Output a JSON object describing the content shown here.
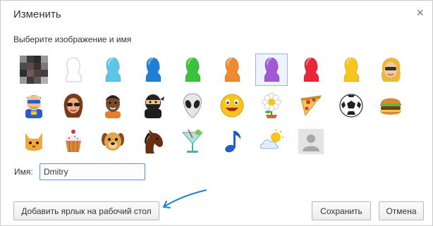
{
  "dialog": {
    "title": "Изменить",
    "close_glyph": "×",
    "subtitle": "Выберите изображение и имя",
    "selected_avatar": "avatar-purple",
    "avatars": [
      {
        "name": "avatar-pixelated-photo",
        "row": 0,
        "col": 0
      },
      {
        "name": "avatar-white",
        "row": 0,
        "col": 1,
        "color": "#ffffff"
      },
      {
        "name": "avatar-cyan",
        "row": 0,
        "col": 2,
        "color": "#5bc6e8"
      },
      {
        "name": "avatar-blue",
        "row": 0,
        "col": 3,
        "color": "#1f7fd6"
      },
      {
        "name": "avatar-green",
        "row": 0,
        "col": 4,
        "color": "#39c23a"
      },
      {
        "name": "avatar-orange",
        "row": 0,
        "col": 5,
        "color": "#f08a2c"
      },
      {
        "name": "avatar-purple",
        "row": 0,
        "col": 6,
        "color": "#a159d6"
      },
      {
        "name": "avatar-red",
        "row": 0,
        "col": 7,
        "color": "#e8283a"
      },
      {
        "name": "avatar-yellow",
        "row": 0,
        "col": 8,
        "color": "#f7c51b"
      },
      {
        "name": "avatar-blonde-woman",
        "row": 0,
        "col": 9
      },
      {
        "name": "avatar-superhero",
        "row": 1,
        "col": 0
      },
      {
        "name": "avatar-woman-sunglasses",
        "row": 1,
        "col": 1
      },
      {
        "name": "avatar-man",
        "row": 1,
        "col": 2
      },
      {
        "name": "avatar-ninja",
        "row": 1,
        "col": 3
      },
      {
        "name": "avatar-alien",
        "row": 1,
        "col": 4
      },
      {
        "name": "avatar-smiley",
        "row": 1,
        "col": 5
      },
      {
        "name": "avatar-flower",
        "row": 1,
        "col": 6
      },
      {
        "name": "avatar-pizza",
        "row": 1,
        "col": 7
      },
      {
        "name": "avatar-soccer-ball",
        "row": 1,
        "col": 8
      },
      {
        "name": "avatar-burger",
        "row": 1,
        "col": 9
      },
      {
        "name": "avatar-cat",
        "row": 2,
        "col": 0
      },
      {
        "name": "avatar-cupcake",
        "row": 2,
        "col": 1
      },
      {
        "name": "avatar-dog",
        "row": 2,
        "col": 2
      },
      {
        "name": "avatar-horse",
        "row": 2,
        "col": 3
      },
      {
        "name": "avatar-cocktail",
        "row": 2,
        "col": 4
      },
      {
        "name": "avatar-music-note",
        "row": 2,
        "col": 5
      },
      {
        "name": "avatar-sun-cloud",
        "row": 2,
        "col": 6
      },
      {
        "name": "avatar-default-gray",
        "row": 2,
        "col": 7
      }
    ],
    "name_label": "Имя:",
    "name_value": "Dmitry",
    "shortcut_button": "Добавить ярлык на рабочий стол",
    "save_button": "Сохранить",
    "cancel_button": "Отмена",
    "accent_color": "#1a73d6"
  }
}
